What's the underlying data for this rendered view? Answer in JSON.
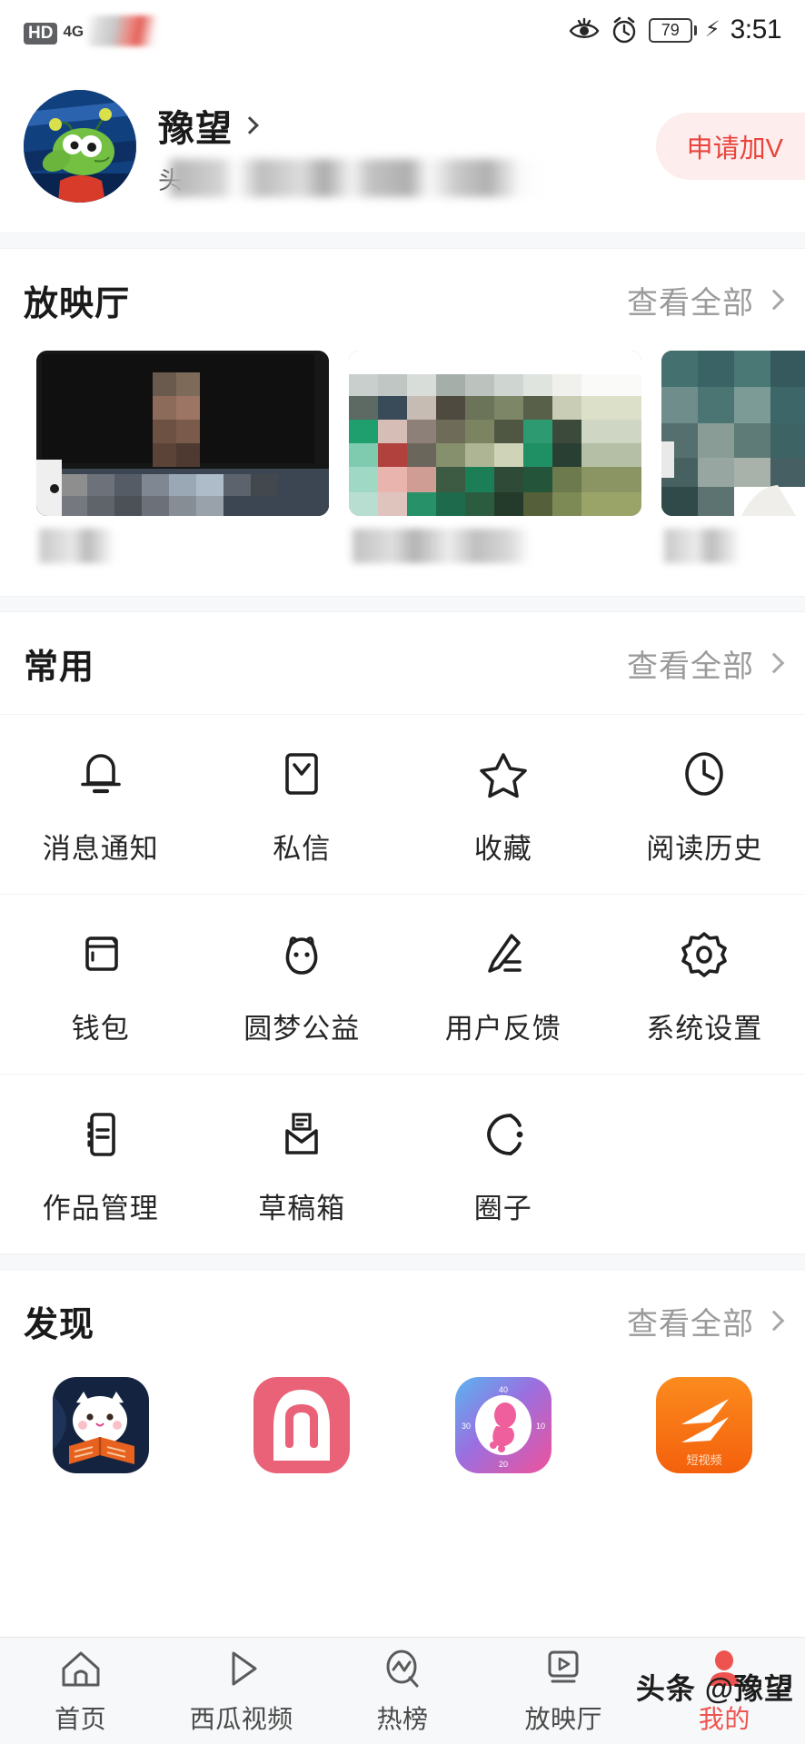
{
  "statusbar": {
    "hd_label": "HD",
    "network": "4G",
    "battery_level": "79",
    "time": "3:51",
    "icons": [
      "eye-care-icon",
      "alarm-clock-icon",
      "battery-icon",
      "charging-bolt-icon"
    ]
  },
  "profile": {
    "username": "豫望",
    "subtitle_visible_char": "头",
    "verify_button_label": "申请加V",
    "avatar_alt": "cartoon-alien-avatar"
  },
  "screening_room": {
    "title": "放映厅",
    "more_label": "查看全部",
    "cards": [
      {
        "thumb_alt": "dark-classroom-video-thumb",
        "title_blurred": true
      },
      {
        "thumb_alt": "green-outdoor-video-thumb",
        "title_blurred": true
      },
      {
        "thumb_alt": "teal-indoor-video-thumb",
        "title_blurred": true
      }
    ]
  },
  "common": {
    "title": "常用",
    "more_label": "查看全部",
    "rows": [
      [
        {
          "icon": "bell-icon",
          "label": "消息通知"
        },
        {
          "icon": "envelope-icon",
          "label": "私信"
        },
        {
          "icon": "star-icon",
          "label": "收藏"
        },
        {
          "icon": "clock-icon",
          "label": "阅读历史"
        }
      ],
      [
        {
          "icon": "wallet-icon",
          "label": "钱包"
        },
        {
          "icon": "cat-face-icon",
          "label": "圆梦公益"
        },
        {
          "icon": "pencil-feedback-icon",
          "label": "用户反馈"
        },
        {
          "icon": "gear-icon",
          "label": "系统设置"
        }
      ],
      [
        {
          "icon": "document-list-icon",
          "label": "作品管理"
        },
        {
          "icon": "open-envelope-icon",
          "label": "草稿箱"
        },
        {
          "icon": "tag-circle-icon",
          "label": "圈子"
        }
      ]
    ]
  },
  "discover": {
    "title": "发现",
    "more_label": "查看全部",
    "apps": [
      {
        "name": "white-cat-reading-app-icon",
        "bg": "#12203d"
      },
      {
        "name": "pink-m-app-icon",
        "bg": "#e8627a"
      },
      {
        "name": "pregnancy-tracker-app-icon",
        "bg": "#5b9ee8"
      },
      {
        "name": "short-video-app-icon",
        "bg": "#f57920",
        "label": "短视频"
      }
    ]
  },
  "bottom_nav": {
    "items": [
      {
        "icon": "home-icon",
        "label": "首页",
        "active": false
      },
      {
        "icon": "play-triangle-icon",
        "label": "西瓜视频",
        "active": false
      },
      {
        "icon": "trending-circle-icon",
        "label": "热榜",
        "active": false
      },
      {
        "icon": "video-box-icon",
        "label": "放映厅",
        "active": false
      },
      {
        "icon": "person-icon",
        "label": "我的",
        "active": true
      }
    ]
  },
  "watermark": {
    "text": "头条 @豫望"
  },
  "colors": {
    "accent_red": "#ef5350",
    "verify_bg": "#fdeded",
    "verify_text": "#e8443c",
    "section_bg": "#f7f8f9",
    "text_primary": "#1a1a1a",
    "text_muted": "#9a9a9a"
  }
}
